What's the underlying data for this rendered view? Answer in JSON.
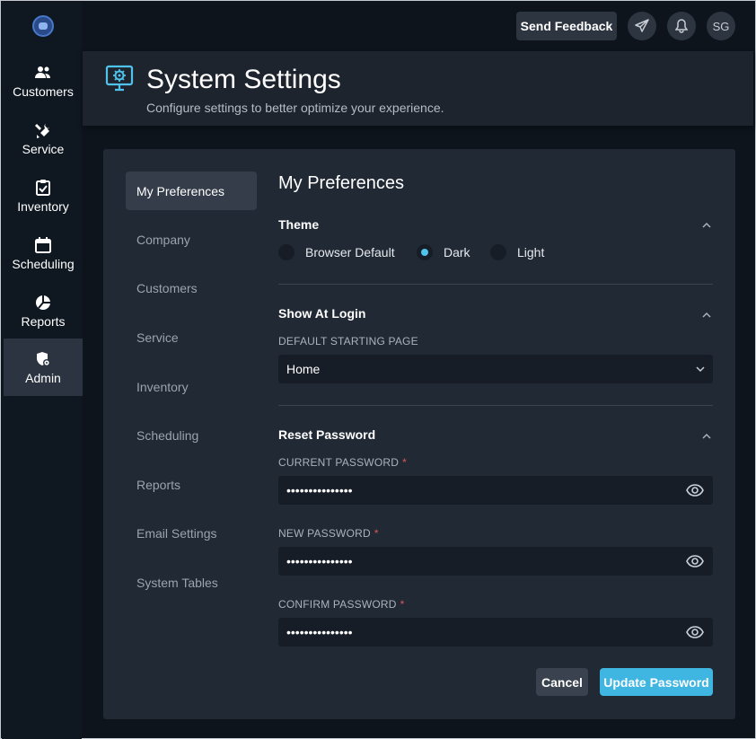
{
  "nav": {
    "items": [
      {
        "label": "Customers",
        "icon": "users-icon"
      },
      {
        "label": "Service",
        "icon": "tools-icon"
      },
      {
        "label": "Inventory",
        "icon": "clipboard-check-icon"
      },
      {
        "label": "Scheduling",
        "icon": "calendar-icon"
      },
      {
        "label": "Reports",
        "icon": "pie-chart-icon"
      },
      {
        "label": "Admin",
        "icon": "shield-gear-icon",
        "active": true
      }
    ]
  },
  "topbar": {
    "feedback_label": "Send Feedback",
    "user_initials": "SG"
  },
  "header": {
    "title": "System Settings",
    "subtitle": "Configure settings to better optimize your experience."
  },
  "subnav": {
    "items": [
      "My Preferences",
      "Company",
      "Customers",
      "Service",
      "Inventory",
      "Scheduling",
      "Reports",
      "Email Settings",
      "System Tables"
    ]
  },
  "panel": {
    "title": "My Preferences",
    "theme": {
      "title": "Theme",
      "options": [
        "Browser Default",
        "Dark",
        "Light"
      ],
      "selected": "Dark"
    },
    "login": {
      "title": "Show At Login",
      "field_label": "DEFAULT STARTING PAGE",
      "value": "Home"
    },
    "reset": {
      "title": "Reset Password",
      "current_label": "CURRENT PASSWORD",
      "new_label": "NEW PASSWORD",
      "confirm_label": "CONFIRM PASSWORD",
      "masked": "•••••••••••••••",
      "required_mark": "*",
      "cancel_label": "Cancel",
      "update_label": "Update Password"
    }
  },
  "colors": {
    "accent": "#3fb5e2",
    "required": "#e05656",
    "background": "#0d141c",
    "card": "#212935"
  }
}
